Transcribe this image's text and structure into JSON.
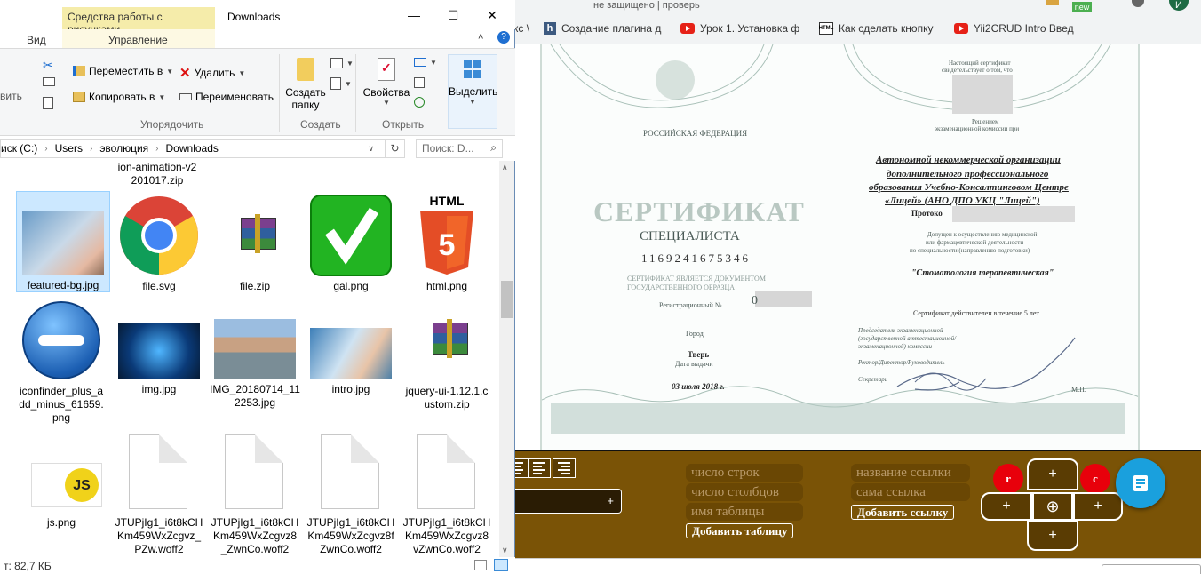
{
  "explorer": {
    "title": "Downloads",
    "context_tab": "Средства работы с рисунками",
    "tabs": [
      "Вид",
      "Управление"
    ],
    "ribbon": {
      "move_to": "Переместить в",
      "delete": "Удалить",
      "copy_to": "Копировать в",
      "rename": "Переименовать",
      "new_folder": "Создать\nпапку",
      "new_folder_l1": "Создать",
      "new_folder_l2": "папку",
      "properties": "Свойства",
      "select": "Выделить",
      "group_organize": "Упорядочить",
      "group_create": "Создать",
      "group_open": "Открыть",
      "left_cut": "вить"
    },
    "address": [
      "иск (C:)",
      "Users",
      "эволюция",
      "Downloads"
    ],
    "search_placeholder": "Поиск: D...",
    "status": "т: 82,7 КБ",
    "files": [
      {
        "name": "ion-animation-v2\n201017.zip",
        "l1": "ion-animation-v2",
        "l2": "201017.zip"
      },
      {
        "name": "featured-bg.jpg"
      },
      {
        "name": "file.svg"
      },
      {
        "name": "file.zip"
      },
      {
        "name": "gal.png"
      },
      {
        "name": "html.png"
      },
      {
        "name": "iconfinder_plus_add_minus_61659.png",
        "l1": "iconfinder_plus_a",
        "l2": "dd_minus_61659.",
        "l3": "png"
      },
      {
        "name": "img.jpg"
      },
      {
        "name": "IMG_20180714_112253.jpg",
        "l1": "IMG_20180714_11",
        "l2": "2253.jpg"
      },
      {
        "name": "intro.jpg"
      },
      {
        "name": "jquery-ui-1.12.1.custom.zip",
        "l1": "jquery-ui-1.12.1.c",
        "l2": "ustom.zip"
      },
      {
        "name": "js.png"
      },
      {
        "name": "JTUPjIg1_i6t8kCHKm459WxZcgvz_PZw.woff2",
        "l1": "JTUPjIg1_i6t8kCH",
        "l2": "Km459WxZcgvz_",
        "l3": "PZw.woff2"
      },
      {
        "name": "JTUPjIg1_i6t8kCHKm459WxZcgvz8_ZwnCo.woff2",
        "l1": "JTUPjIg1_i6t8kCH",
        "l2": "Km459WxZcgvz8",
        "l3": "_ZwnCo.woff2"
      },
      {
        "name": "JTUPjIg1_i6t8kCHKm459WxZcgvz8fZwnCo.woff2",
        "l1": "JTUPjIg1_i6t8kCH",
        "l2": "Km459WxZcgvz8f",
        "l3": "ZwnCo.woff2"
      },
      {
        "name": "JTUPjIg1_i6t8kCHKm459WxZcgvz8vZwnCo.woff2",
        "l1": "JTUPjIg1_i6t8kCH",
        "l2": "Km459WxZcgvz8",
        "l3": "vZwnCo.woff2"
      }
    ]
  },
  "browser": {
    "bookmarks": [
      "кс \\",
      "Создание плагина д",
      "Урок 1. Установка ф",
      "Как сделать кнопку",
      "Yii2CRUD Intro Введ"
    ],
    "badge_new": "new",
    "avatar_letter": "И",
    "top_tab_text": "не защищено | проверь"
  },
  "certificate": {
    "country": "РОССИЙСКАЯ ФЕДЕРАЦИЯ",
    "title": "СЕРТИФИКАТ",
    "subtitle": "СПЕЦИАЛИСТА",
    "number": "1169241675346",
    "is_document": "СЕРТИФИКАТ ЯВЛЯЕТСЯ ДОКУМЕНТОМ",
    "state_format": "ГОСУДАРСТВЕННОГО ОБРАЗЦА",
    "reg_number": "Регистрационный №",
    "reg_value": "0",
    "city_label": "Город",
    "city": "Тверь",
    "issue_label": "Дата выдачи",
    "issue_date": "03 июля 2018 г.",
    "present": "Настоящий сертификат",
    "testifies": "свидетельствует о том, что",
    "decision": "Решением",
    "commission": "экзаменационной комиссии при",
    "org1": "Автономной некоммерческой организации",
    "org2": "дополнительного профессионального",
    "org3": "образования Учебно-Консалтинговом Центре",
    "org4": "«Лицей» (АНО ДПО УКЦ \"Лицей\")",
    "protocol": "Протоко",
    "admitted1": "Допущен к осуществлению медицинской",
    "admitted2": "или фармацевтической деятельности",
    "admitted3": "по специальности (направлению подготовки)",
    "specialty": "\"Стоматология терапевтическая\"",
    "valid": "Сертификат действителен в течение 5 лет.",
    "chair1": "Председатель экзаменационной",
    "chair2": "(государственной аттестационной/",
    "chair3": "экзаменационной) комиссии",
    "rector": "Ректор/Директор/Руководитель",
    "secretary": "Секретарь",
    "mp": "М.П."
  },
  "panel": {
    "rows": "число строк",
    "cols": "число столбцов",
    "table_name": "имя таблицы",
    "add_table": "Добавить таблицу",
    "link_name": "название ссылки",
    "link_self": "сама ссылка",
    "add_link": "Добавить ссылку",
    "plus": "+",
    "r": "r",
    "c": "c"
  },
  "colors": {
    "panel_bg": "#7a5306",
    "panel_btn": "#6a4704",
    "red": "#e8000b",
    "fab": "#1aa0dd",
    "selection": "#cce8ff"
  }
}
